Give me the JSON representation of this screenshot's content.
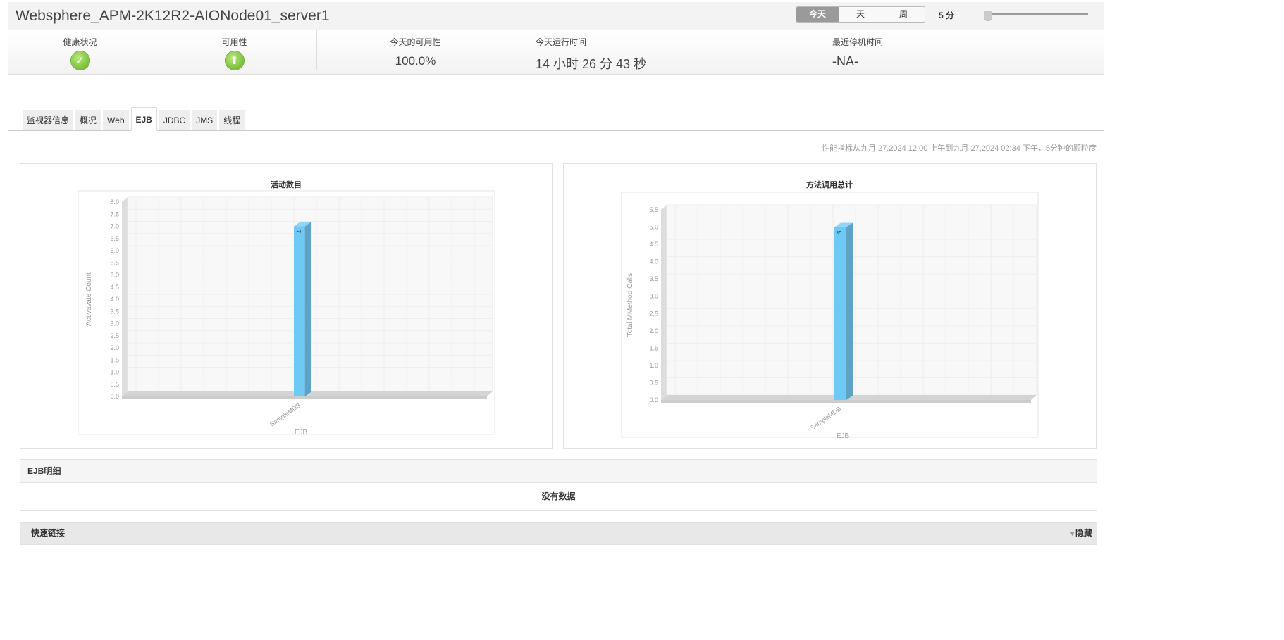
{
  "header": {
    "title": "Websphere_APM-2K12R2-AIONode01_server1",
    "periods": [
      "今天",
      "天",
      "周"
    ],
    "selected_period": "今天",
    "granularity": "5 分",
    "slider_value": 0
  },
  "stats": {
    "health_label": "健康状况",
    "health_icon": "check-circle-icon",
    "availability_label": "可用性",
    "availability_icon": "up-arrow-icon",
    "today_avail_label": "今天的可用性",
    "today_avail_value": "100.0%",
    "uptime_label": "今天运行时间",
    "uptime_value": "14 小时 26 分 43 秒",
    "downtime_label": "最近停机时间",
    "downtime_value": "-NA-"
  },
  "tabs": [
    "监视器信息",
    "概况",
    "Web",
    "EJB",
    "JDBC",
    "JMS",
    "线程"
  ],
  "active_tab": "EJB",
  "range_text": "性能指标从九月 27,2024 12:00 上午到九月 27,2024 02:34 下午，5分钟的颗粒度",
  "colors": {
    "bar": "#6ec9f5",
    "bar_side": "#5ea3c6"
  },
  "chart_data": [
    {
      "type": "bar",
      "title": "活动数目",
      "categories": [
        "SampleMDB"
      ],
      "values": [
        7
      ],
      "value_labels": [
        "7"
      ],
      "xlabel": "EJB",
      "ylabel": "Activavate Count",
      "ylim": [
        0,
        8
      ],
      "ticks": [
        "0.0",
        "0.5",
        "1.0",
        "1.5",
        "2.0",
        "2.5",
        "3.0",
        "3.5",
        "4.0",
        "4.5",
        "5.0",
        "5.5",
        "6.0",
        "6.5",
        "7.0",
        "7.5",
        "8.0"
      ],
      "grid": true
    },
    {
      "type": "bar",
      "title": "方法调用总计",
      "categories": [
        "SampleMDB"
      ],
      "values": [
        5
      ],
      "value_labels": [
        "5"
      ],
      "xlabel": "EJB",
      "ylabel": "Total MMethod Calls",
      "ylim": [
        0,
        5.5
      ],
      "ticks": [
        "0.0",
        "0.5",
        "1.0",
        "1.5",
        "2.0",
        "2.5",
        "3.0",
        "3.5",
        "4.0",
        "4.5",
        "5.0",
        "5.5"
      ],
      "grid": true
    }
  ],
  "ejb_detail": {
    "title": "EJB明细",
    "empty": "没有数据"
  },
  "quick_links": {
    "title": "快速链接",
    "hide": "隐藏"
  }
}
